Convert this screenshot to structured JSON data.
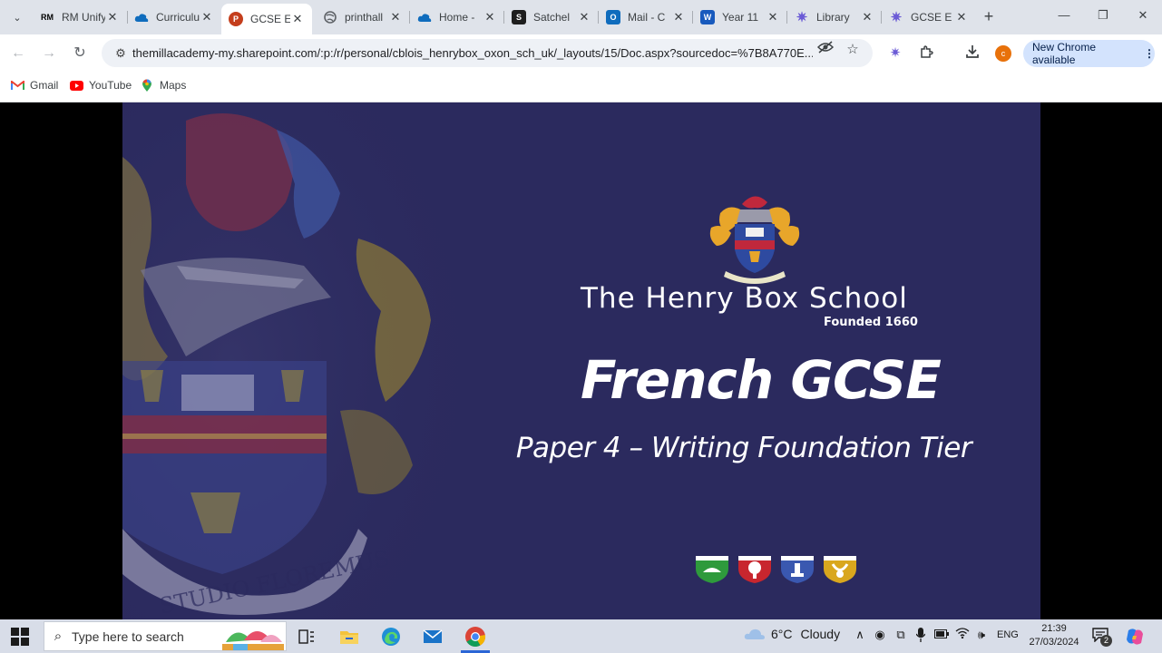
{
  "browser": {
    "tabs": [
      {
        "title": "RM Unify",
        "favicon": "rm-icon",
        "color": "#000000",
        "active": false
      },
      {
        "title": "Curriculum",
        "favicon": "onedrive-cloud-icon",
        "color": "#0f6cbd",
        "active": false
      },
      {
        "title": "GCSE E",
        "favicon": "powerpoint-icon",
        "color": "#c43e1c",
        "active": true
      },
      {
        "title": "printhall",
        "favicon": "globe-icon",
        "color": "#5f6368",
        "active": false
      },
      {
        "title": "Home -",
        "favicon": "onedrive-cloud-icon",
        "color": "#0f6cbd",
        "active": false
      },
      {
        "title": "Satchel",
        "favicon": "satchel-icon",
        "color": "#1e1e1e",
        "active": false
      },
      {
        "title": "Mail - C",
        "favicon": "outlook-icon",
        "color": "#0f6cbd",
        "active": false
      },
      {
        "title": "Year 11",
        "favicon": "word-icon",
        "color": "#185abd",
        "active": false
      },
      {
        "title": "Library",
        "favicon": "library-icon",
        "color": "#6b5bd6",
        "active": false
      },
      {
        "title": "GCSE E",
        "favicon": "library-icon",
        "color": "#6b5bd6",
        "active": false
      }
    ],
    "url": "themillacademy-my.sharepoint.com/:p:/r/personal/cblois_henrybox_oxon_sch_uk/_layouts/15/Doc.aspx?sourcedoc=%7B8A770E...",
    "profile_initial": "c",
    "update_label": "New Chrome available",
    "bookmarks": [
      {
        "label": "Gmail",
        "icon": "gmail-icon"
      },
      {
        "label": "YouTube",
        "icon": "youtube-icon"
      },
      {
        "label": "Maps",
        "icon": "maps-icon"
      }
    ]
  },
  "slide": {
    "school_name": "The Henry Box School",
    "founded": "Founded 1660",
    "title": "French GCSE",
    "subtitle": "Paper 4 – Writing Foundation Tier",
    "background_color": "#2b2a5e"
  },
  "taskbar": {
    "search_placeholder": "Type here to search",
    "weather": {
      "temp": "6°C",
      "condition": "Cloudy"
    },
    "language": "ENG",
    "time": "21:39",
    "date": "27/03/2024",
    "notifications": "2"
  }
}
